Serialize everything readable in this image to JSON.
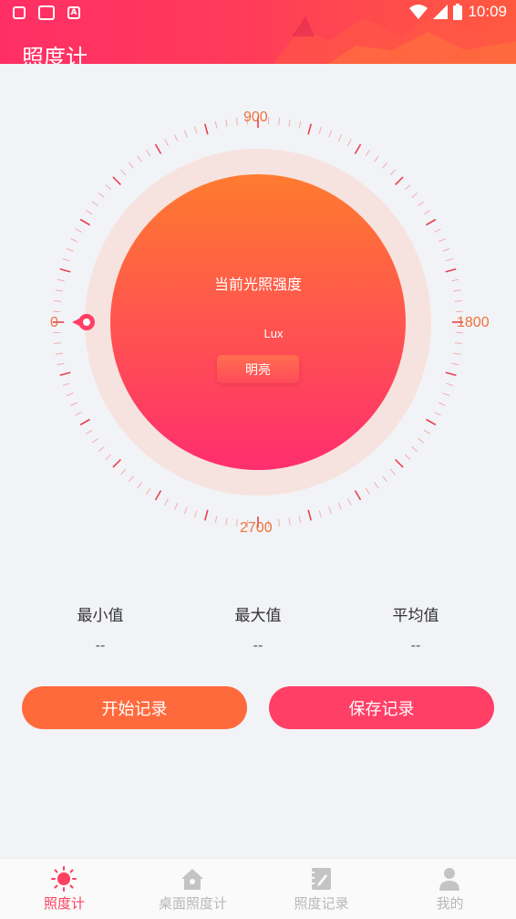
{
  "status_bar": {
    "time": "10:09"
  },
  "header": {
    "title": "照度计"
  },
  "dial": {
    "scale_labels": {
      "top": "900",
      "right": "1800",
      "bottom": "2700",
      "left": "0"
    },
    "current_label": "当前光照强度",
    "unit": "Lux",
    "level_badge": "明亮",
    "pointer_value": 0,
    "max_value": 3600
  },
  "stats": [
    {
      "label": "最小值",
      "value": "--"
    },
    {
      "label": "最大值",
      "value": "--"
    },
    {
      "label": "平均值",
      "value": "--"
    }
  ],
  "buttons": {
    "start": "开始记录",
    "save": "保存记录"
  },
  "tabs": [
    {
      "label": "照度计",
      "icon": "sun-icon",
      "active": true
    },
    {
      "label": "桌面照度计",
      "icon": "home-icon",
      "active": false
    },
    {
      "label": "照度记录",
      "icon": "notebook-icon",
      "active": false
    },
    {
      "label": "我的",
      "icon": "person-icon",
      "active": false
    }
  ],
  "colors": {
    "accent": "#ff3f5e",
    "orange": "#ff6a3d",
    "dial_ring": "#f6e3df"
  }
}
